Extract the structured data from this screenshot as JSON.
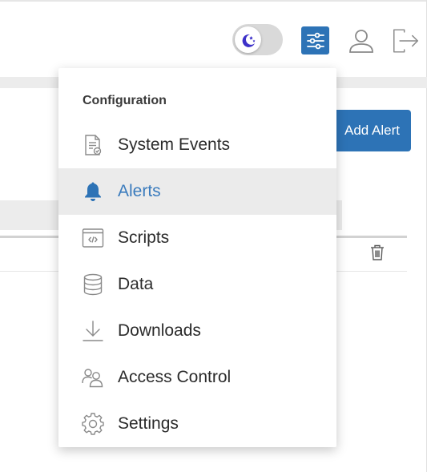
{
  "header": {
    "theme_toggle_icon": "moon-stars-icon",
    "config_icon": "sliders-icon",
    "user_icon": "user-icon",
    "logout_icon": "logout-icon",
    "accent_color": "#2d73b6"
  },
  "page": {
    "add_alert_label": "Add Alert",
    "row_action_icon": "trash-icon"
  },
  "menu": {
    "heading": "Configuration",
    "active_color": "#3a7bbd",
    "items": [
      {
        "label": "System Events",
        "icon": "document-check-icon"
      },
      {
        "label": "Alerts",
        "icon": "bell-icon",
        "active": true
      },
      {
        "label": "Scripts",
        "icon": "code-window-icon"
      },
      {
        "label": "Data",
        "icon": "database-icon"
      },
      {
        "label": "Downloads",
        "icon": "download-icon"
      },
      {
        "label": "Access Control",
        "icon": "users-icon"
      },
      {
        "label": "Settings",
        "icon": "gear-icon"
      }
    ]
  }
}
